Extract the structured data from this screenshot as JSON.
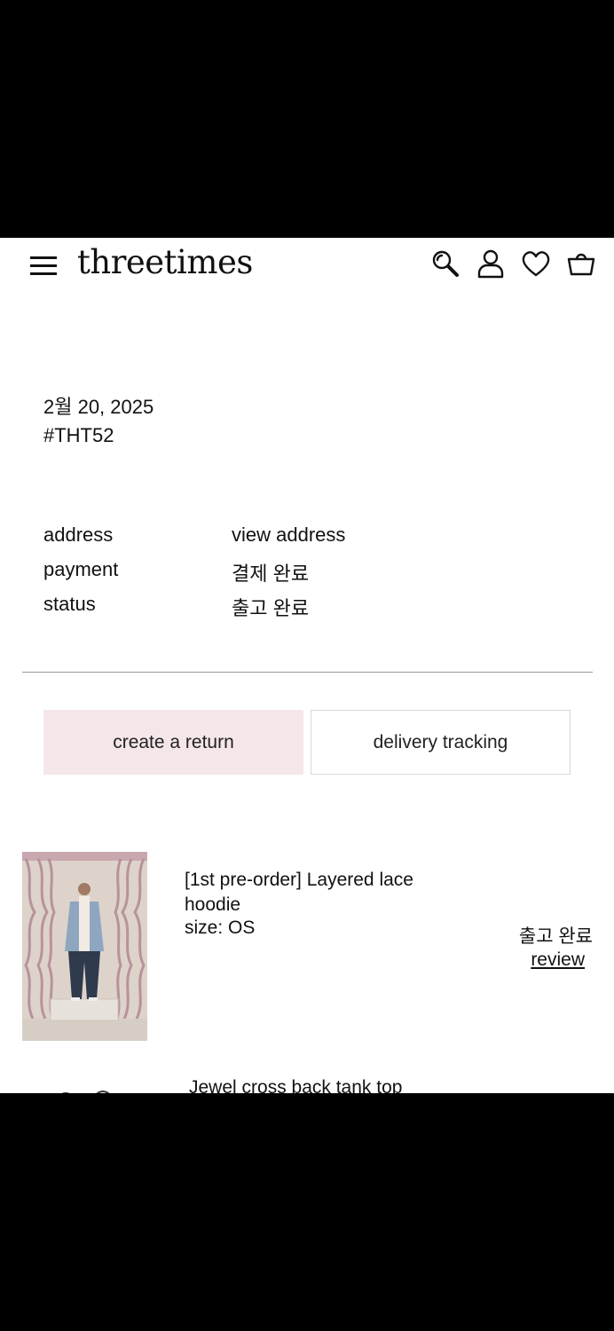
{
  "header": {
    "brand": "threetimes",
    "icons": [
      "menu-icon",
      "search-icon",
      "account-icon",
      "heart-icon",
      "shopping-bag-icon"
    ]
  },
  "order": {
    "date": "2월 20, 2025",
    "number": "#THT52"
  },
  "info": {
    "address_label": "address",
    "address_value": "view address",
    "payment_label": "payment",
    "payment_value": "결제 완료",
    "status_label": "status",
    "status_value": "출고 완료"
  },
  "actions": {
    "return_label": "create a return",
    "tracking_label": "delivery tracking"
  },
  "items": [
    {
      "name": "[1st pre-order] Layered lace hoodie",
      "size": "size: OS",
      "status": "출고 완료",
      "review": "review"
    },
    {
      "name": "Jewel cross back tank top"
    }
  ],
  "colors": {
    "return_button_bg": "#f5e6e9",
    "divider": "#9a9a9a"
  }
}
